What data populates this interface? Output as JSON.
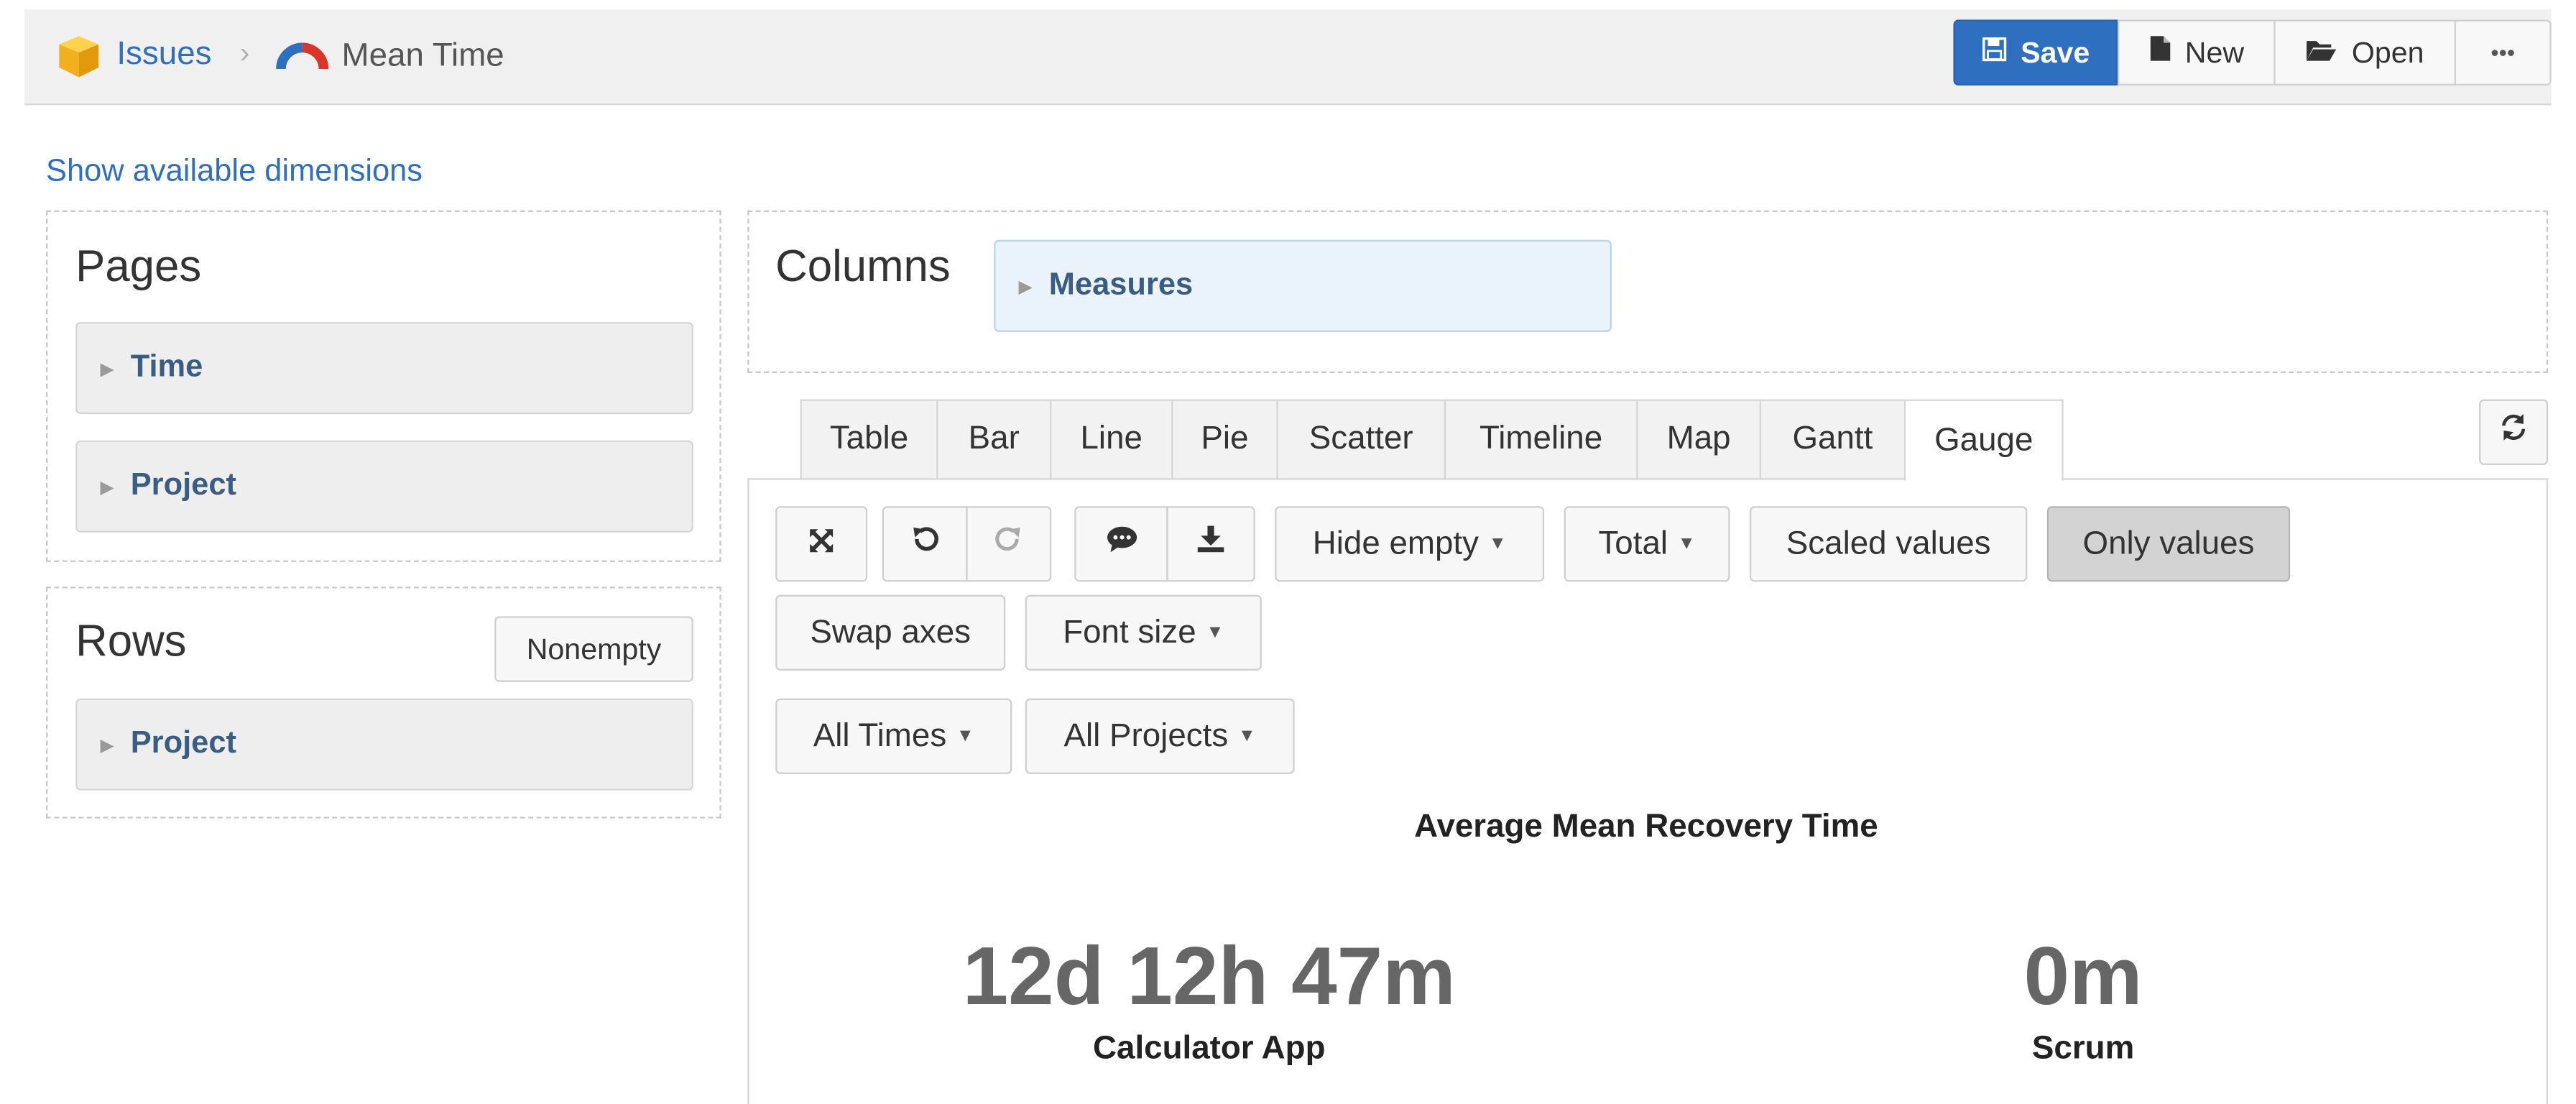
{
  "breadcrumb": {
    "root": "Issues",
    "separator": "›",
    "current": "Mean Time"
  },
  "toolbar": {
    "save": "Save",
    "new": "New",
    "open": "Open",
    "more": "•••"
  },
  "show_dimensions_link": "Show available dimensions",
  "pages_panel": {
    "title": "Pages",
    "items": [
      "Time",
      "Project"
    ]
  },
  "rows_panel": {
    "title": "Rows",
    "nonempty_button": "Nonempty",
    "items": [
      "Project"
    ]
  },
  "columns_panel": {
    "title": "Columns",
    "items": [
      "Measures"
    ]
  },
  "tabs": [
    "Table",
    "Bar",
    "Line",
    "Pie",
    "Scatter",
    "Timeline",
    "Map",
    "Gantt",
    "Gauge"
  ],
  "active_tab": "Gauge",
  "chart_toolbar": {
    "hide_empty": "Hide empty",
    "total": "Total",
    "scaled_values": "Scaled values",
    "only_values": "Only values",
    "swap_axes": "Swap axes",
    "font_size": "Font size",
    "all_times": "All Times",
    "all_projects": "All Projects"
  },
  "icons": {
    "fullscreen": "fullscreen-icon",
    "undo": "undo-icon",
    "redo": "redo-icon",
    "comment": "comment-icon",
    "download": "download-icon",
    "refresh": "refresh-icon"
  },
  "gauge": {
    "title": "Average Mean Recovery Time",
    "values": [
      {
        "value": "12d 12h 47m",
        "label": "Calculator App"
      },
      {
        "value": "0m",
        "label": "Scrum"
      }
    ]
  },
  "colors": {
    "accent": "#2f6fbf",
    "dimension_label": "#3a5d84",
    "gauge_value": "#666666"
  }
}
